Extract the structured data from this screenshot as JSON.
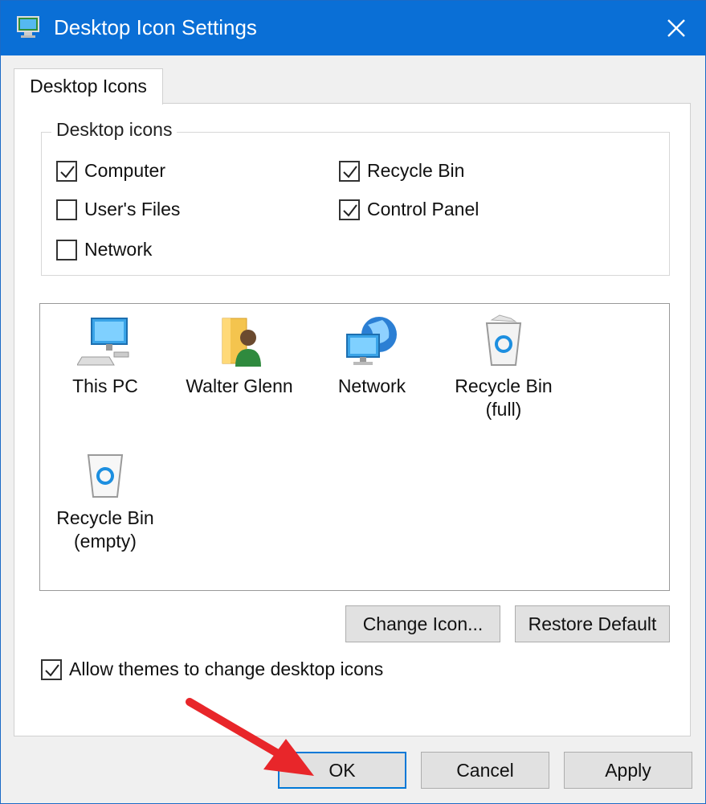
{
  "window": {
    "title": "Desktop Icon Settings"
  },
  "tabs": [
    {
      "label": "Desktop Icons"
    }
  ],
  "desktop_icons_group": {
    "label": "Desktop icons",
    "items": [
      {
        "label": "Computer",
        "checked": true
      },
      {
        "label": "Recycle Bin",
        "checked": true
      },
      {
        "label": "User's Files",
        "checked": false
      },
      {
        "label": "Control Panel",
        "checked": true
      },
      {
        "label": "Network",
        "checked": false
      }
    ]
  },
  "icon_list": [
    {
      "label": "This PC",
      "icon": "computer-icon"
    },
    {
      "label": "Walter Glenn",
      "icon": "user-folder-icon"
    },
    {
      "label": "Network",
      "icon": "network-icon"
    },
    {
      "label": "Recycle Bin\n(full)",
      "line1": "Recycle Bin",
      "line2": "(full)",
      "icon": "recycle-bin-full-icon"
    },
    {
      "label": "Recycle Bin\n(empty)",
      "line1": "Recycle Bin",
      "line2": "(empty)",
      "icon": "recycle-bin-empty-icon"
    }
  ],
  "buttons": {
    "change_icon": "Change Icon...",
    "restore_default": "Restore Default",
    "ok": "OK",
    "cancel": "Cancel",
    "apply": "Apply"
  },
  "allow_themes": {
    "label": "Allow themes to change desktop icons",
    "checked": true
  },
  "colors": {
    "titlebar": "#0a6fd6",
    "accent": "#0078d7",
    "arrow": "#e8262a"
  }
}
